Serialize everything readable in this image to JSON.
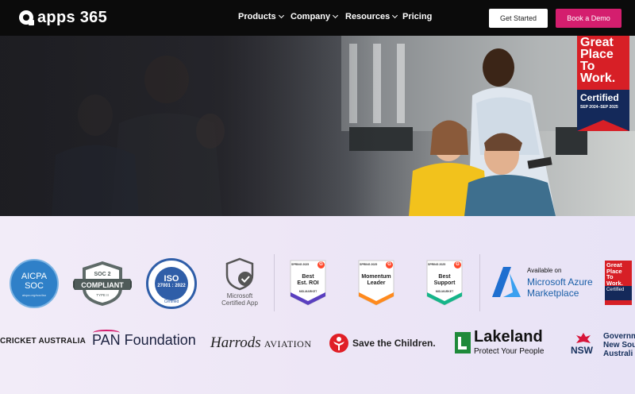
{
  "nav": {
    "logo_text": "apps 365",
    "items": [
      {
        "label": "Products",
        "has_dropdown": true
      },
      {
        "label": "Company",
        "has_dropdown": true
      },
      {
        "label": "Resources",
        "has_dropdown": true
      },
      {
        "label": "Pricing",
        "has_dropdown": false
      }
    ],
    "get_started_label": "Get Started",
    "book_demo_label": "Book a Demo"
  },
  "hero": {
    "award": {
      "line1": "Great",
      "line2": "Place",
      "line3": "To",
      "line4": "Work.",
      "certified": "Certified",
      "dates": "SEP 2024–SEP 2025"
    }
  },
  "badges": {
    "aicpa": {
      "line1": "AICPA",
      "line2": "SOC",
      "small": "aicpa.org/soc4so"
    },
    "soc2": {
      "title": "SOC 2",
      "main": "COMPLIANT",
      "sub": "TYPE II"
    },
    "iso": {
      "ring": "Information Security Management System",
      "main": "ISO",
      "number": "27001 : 2022",
      "cert": "Certified"
    },
    "microsoft_app": {
      "line1": "Microsoft",
      "line2": "Certified App"
    },
    "g2": [
      {
        "season": "SPRING 2025",
        "label": "Best Est. ROI",
        "label_line1": "Best",
        "label_line2": "Est. ROI",
        "sub": "MID-MARKET",
        "color": "#5a3fc0"
      },
      {
        "season": "SPRING 2025",
        "label_line1": "Momentum",
        "label_line2": "Leader",
        "sub": "",
        "color": "#ff8a1e"
      },
      {
        "season": "SPRING 2025",
        "label_line1": "Best",
        "label_line2": "Support",
        "sub": "MID-MARKET",
        "color": "#16b58a"
      }
    ],
    "g2_mark": "G",
    "azure": {
      "available": "Available on",
      "line1": "Microsoft Azure",
      "line2": "Marketplace"
    },
    "gptw_small": {
      "line1": "Great",
      "line2": "Place",
      "line3": "To",
      "line4": "Work.",
      "certified": "Certified"
    }
  },
  "clients": {
    "cricket": "CRICKET AUSTRALIA",
    "pan": "PAN Foundation",
    "harrods": "Harrods",
    "harrods_aviation": "AVIATION",
    "save_children": "Save the Children.",
    "lakeland": "Lakeland",
    "lakeland_sub": "Protect Your People",
    "nsw": "NSW",
    "nsw_gov_line1": "Governm",
    "nsw_gov_line2": "New Sou",
    "nsw_gov_line3": "Australi"
  },
  "colors": {
    "accent": "#d41e6e",
    "nav_bg": "#0b0b0b",
    "gptw_red": "#d71f26",
    "gptw_navy": "#14295a"
  }
}
